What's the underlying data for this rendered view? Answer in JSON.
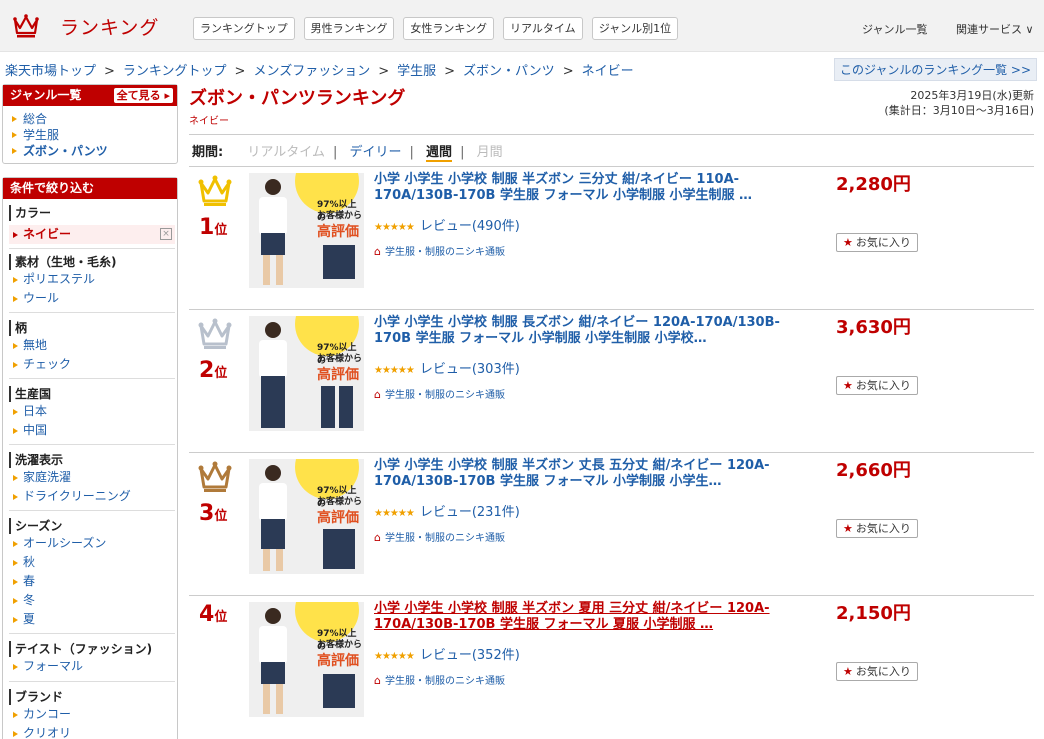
{
  "header": {
    "logo_text": "ランキング",
    "nav": [
      "ランキングトップ",
      "男性ランキング",
      "女性ランキング",
      "リアルタイム",
      "ジャンル別1位"
    ],
    "genre_list": "ジャンル一覧",
    "related": "関連サービス ∨"
  },
  "breadcrumb": [
    "楽天市場トップ",
    "ランキングトップ",
    "メンズファッション",
    "学生服",
    "ズボン・パンツ",
    "ネイビー"
  ],
  "genre_ranking_link": "このジャンルのランキング一覧 >>",
  "sidebar": {
    "genre_title": "ジャンル一覧",
    "see_all": "全て見る",
    "genres": [
      "総合",
      "学生服",
      "ズボン・パンツ"
    ],
    "filter_title": "条件で絞り込む",
    "groups": [
      {
        "title": "カラー",
        "items": [
          "ネイビー"
        ]
      },
      {
        "title": "素材（生地・毛糸)",
        "items": [
          "ポリエステル",
          "ウール"
        ]
      },
      {
        "title": "柄",
        "items": [
          "無地",
          "チェック"
        ]
      },
      {
        "title": "生産国",
        "items": [
          "日本",
          "中国"
        ]
      },
      {
        "title": "洗濯表示",
        "items": [
          "家庭洗濯",
          "ドライクリーニング"
        ]
      },
      {
        "title": "シーズン",
        "items": [
          "オールシーズン",
          "秋",
          "春",
          "冬",
          "夏"
        ]
      },
      {
        "title": "テイスト（ファッション)",
        "items": [
          "フォーマル"
        ]
      },
      {
        "title": "ブランド",
        "items": [
          "カンコー",
          "クリオリ"
        ]
      }
    ]
  },
  "main": {
    "title": "ズボン・パンツランキング",
    "subtitle": "ネイビー",
    "updated": "2025年3月19日(水)更新",
    "period_range": "(集計日：3月10日～3月16日)",
    "period_label": "期間:",
    "periods": [
      "リアルタイム",
      "デイリー",
      "週間",
      "月間"
    ]
  },
  "items": [
    {
      "rank": "1",
      "rank_suffix": "位",
      "name": "小学 小学生 小学校 制服 半ズボン 三分丈 紺/ネイビー 110A-170A/130B-170B 学生服 フォーマル 小学制服 小学生制服 …",
      "stars": "★★★★★",
      "review": "レビュー(490件)",
      "shop": "学生服・制服のニシキ通販",
      "price": "2,280円",
      "fav": "お気に入り"
    },
    {
      "rank": "2",
      "rank_suffix": "位",
      "name": "小学 小学生 小学校 制服 長ズボン 紺/ネイビー 120A-170A/130B-170B 学生服 フォーマル 小学制服 小学生制服 小学校…",
      "stars": "★★★★★",
      "review": "レビュー(303件)",
      "shop": "学生服・制服のニシキ通販",
      "price": "3,630円",
      "fav": "お気に入り"
    },
    {
      "rank": "3",
      "rank_suffix": "位",
      "name": "小学 小学生 小学校 制服 半ズボン 丈長 五分丈 紺/ネイビー 120A-170A/130B-170B 学生服 フォーマル 小学制服 小学生…",
      "stars": "★★★★★",
      "review": "レビュー(231件)",
      "shop": "学生服・制服のニシキ通販",
      "price": "2,660円",
      "fav": "お気に入り"
    },
    {
      "rank": "4",
      "rank_suffix": "位",
      "name": "小学 小学生 小学校 制服 半ズボン 夏用 三分丈 紺/ネイビー 120A-170A/130B-170B 学生服 フォーマル 夏服 小学制服 …",
      "stars": "★★★★★",
      "review": "レビュー(352件)",
      "shop": "学生服・制服のニシキ通販",
      "price": "2,150円",
      "fav": "お気に入り"
    }
  ],
  "thumb_text": {
    "top": "97%以上の",
    "mid": "お客様から",
    "big": "高評価"
  },
  "colors": {
    "brand": "#bf0000",
    "link": "#1f5ea8",
    "gold": "#f0c000",
    "silver": "#b8c0cc",
    "bronze": "#b07a3a"
  }
}
